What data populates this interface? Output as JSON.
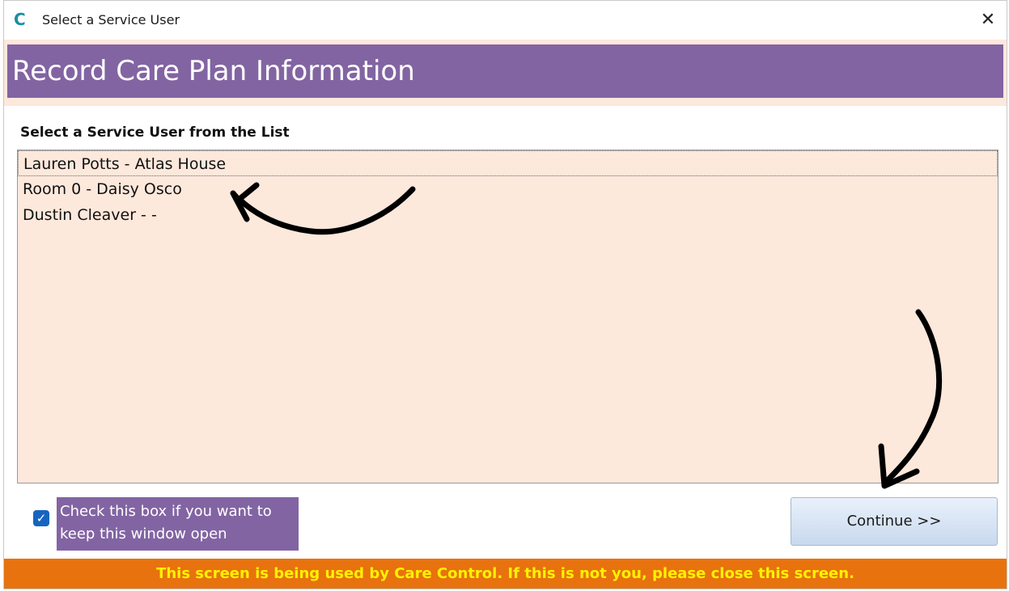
{
  "window": {
    "title": "Select a Service User",
    "app_icon_glyph": "C",
    "close_glyph": "✕"
  },
  "header": {
    "title": "Record Care Plan Information"
  },
  "list": {
    "label": "Select a Service User from the List",
    "items": [
      "Lauren Potts - Atlas House",
      "Room 0 - Daisy Osco",
      "Dustin Cleaver - -"
    ],
    "selected_index": 0
  },
  "keep_open": {
    "checked": true,
    "check_glyph": "✓",
    "label": "Check this box if you want to keep this window open"
  },
  "buttons": {
    "continue_label": "Continue >>"
  },
  "status": {
    "message": "This screen is being used by Care Control.  If this is not you, please close this screen."
  },
  "colors": {
    "header_band": "#8264a3",
    "list_background": "#fde8dc",
    "status_bar": "#e8720e",
    "status_text": "#fff200",
    "app_icon": "#1a8fa0"
  }
}
